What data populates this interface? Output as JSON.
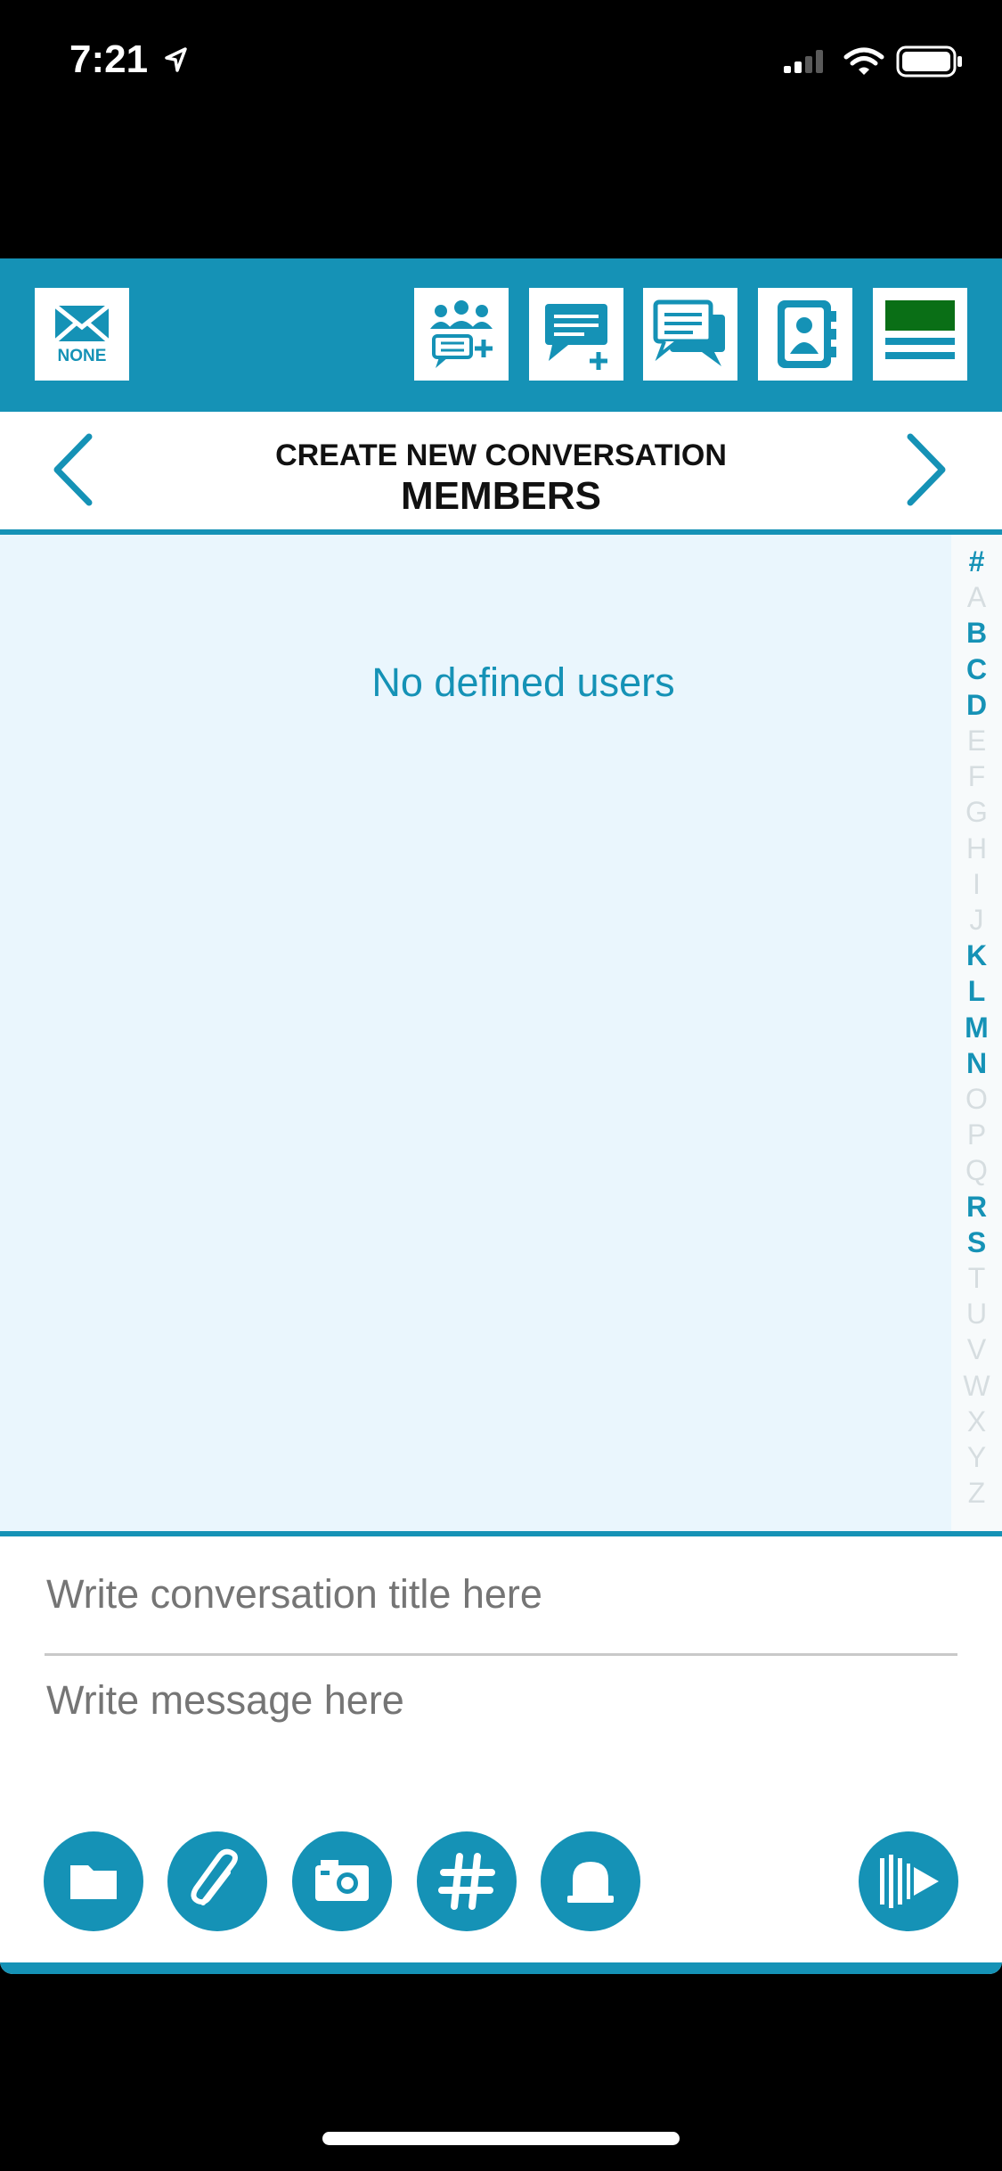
{
  "status_bar": {
    "time": "7:21"
  },
  "toolbar": {
    "mail_badge": "NONE",
    "buttons": [
      "add-group-chat-icon",
      "new-message-icon",
      "conversations-icon",
      "contacts-icon",
      "menu-icon"
    ]
  },
  "nav": {
    "subtitle": "CREATE NEW CONVERSATION",
    "title": "MEMBERS"
  },
  "list": {
    "empty_text": "No defined users"
  },
  "index": {
    "letters": [
      "#",
      "A",
      "B",
      "C",
      "D",
      "E",
      "F",
      "G",
      "H",
      "I",
      "J",
      "K",
      "L",
      "M",
      "N",
      "O",
      "P",
      "Q",
      "R",
      "S",
      "T",
      "U",
      "V",
      "W",
      "X",
      "Y",
      "Z"
    ],
    "active": [
      "#",
      "B",
      "C",
      "D",
      "K",
      "L",
      "M",
      "N",
      "R",
      "S"
    ]
  },
  "compose": {
    "title_placeholder": "Write conversation title here",
    "message_placeholder": "Write message here",
    "actions": [
      "folder-icon",
      "paperclip-icon",
      "camera-icon",
      "hashtag-icon",
      "bell-icon",
      "send-icon"
    ]
  },
  "colors": {
    "accent": "#1592b6",
    "list_bg": "#eaf6fd",
    "inactive_letter": "#d6dde0",
    "placeholder": "#bdbdbd"
  }
}
